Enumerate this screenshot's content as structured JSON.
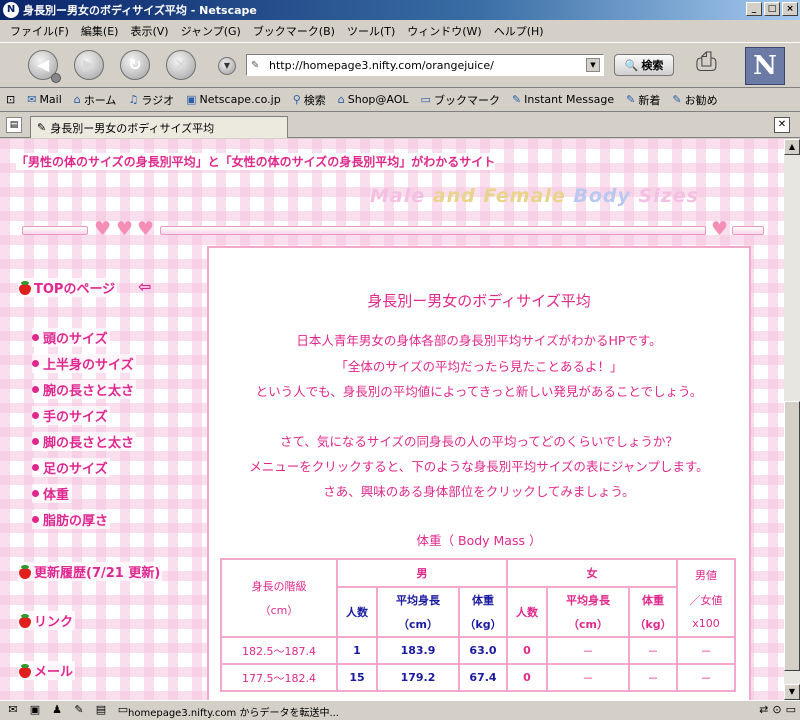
{
  "window": {
    "title": "身長別ー男女のボディサイズ平均 - Netscape",
    "controls": [
      "_",
      "□",
      "×"
    ]
  },
  "menu": [
    "ファイル(F)",
    "編集(E)",
    "表示(V)",
    "ジャンプ(G)",
    "ブックマーク(B)",
    "ツール(T)",
    "ウィンドウ(W)",
    "ヘルプ(H)"
  ],
  "navigation": {
    "url": "http://homepage3.nifty.com/orangejuice/",
    "search_label": "検索",
    "logo_letter": "N"
  },
  "bookmarks": [
    {
      "label": "Mail",
      "icon": "mail-icon"
    },
    {
      "label": "ホーム",
      "icon": "home-icon"
    },
    {
      "label": "ラジオ",
      "icon": "radio-icon"
    },
    {
      "label": "Netscape.co.jp",
      "icon": "netscape-icon"
    },
    {
      "label": "検索",
      "icon": "search-icon"
    },
    {
      "label": "Shop@AOL",
      "icon": "shop-icon"
    },
    {
      "label": "ブックマーク",
      "icon": "folder-icon"
    },
    {
      "label": "Instant Message",
      "icon": "im-icon"
    },
    {
      "label": "新着",
      "icon": "bookmark-icon"
    },
    {
      "label": "お勧め",
      "icon": "bookmark-icon"
    }
  ],
  "tab": {
    "label": "身長別ー男女のボディサイズ平均"
  },
  "page": {
    "tagline": "「男性の体のサイズの身長別平均」と「女性の体のサイズの身長別平均」がわかるサイト",
    "logo": {
      "part1": "Male",
      "part2": "and Female",
      "part3": "Body",
      "part4": "Sizes"
    },
    "sidebar": {
      "top": "TOPのページ",
      "items": [
        "頭のサイズ",
        "上半身のサイズ",
        "腕の長さと太さ",
        "手のサイズ",
        "脚の長さと太さ",
        "足のサイズ",
        "体重",
        "脂肪の厚さ"
      ],
      "history": "更新履歴(7/21 更新)",
      "links": "リンク",
      "mail": "メール"
    },
    "main": {
      "title": "身長別ー男女のボディサイズ平均",
      "intro": [
        "日本人青年男女の身体各部の身長別平均サイズがわかるHPです。",
        "「全体のサイズの平均だったら見たことあるよ！」",
        "という人でも、身長別の平均値によってきっと新しい発見があることでしょう。"
      ],
      "guide": [
        "さて、気になるサイズの同身長の人の平均ってどのくらいでしょうか？",
        "メニューをクリックすると、下のような身長別平均サイズの表にジャンプします。",
        "さあ、興味のある身体部位をクリックしてみましょう。"
      ],
      "table_caption": "体重（ Body Mass ）",
      "table": {
        "h_height": [
          "身長の階級",
          "（cm）"
        ],
        "h_male": "男",
        "h_female": "女",
        "h_ratio": [
          "男値",
          "／女値",
          "x100"
        ],
        "h_count": "人数",
        "h_avg_height": [
          "平均身長",
          "（cm）"
        ],
        "h_weight": [
          "体重",
          "（kg）"
        ],
        "rows": [
          {
            "range": "182.5～187.4",
            "m_count": "1",
            "m_height": "183.9",
            "m_weight": "63.0",
            "f_count": "0",
            "f_height": "－",
            "f_weight": "－",
            "ratio": "－"
          },
          {
            "range": "177.5～182.4",
            "m_count": "15",
            "m_height": "179.2",
            "m_weight": "67.4",
            "f_count": "0",
            "f_height": "－",
            "f_weight": "－",
            "ratio": "－"
          }
        ]
      }
    }
  },
  "status": {
    "text": "homepage3.nifty.com からデータを転送中..."
  }
}
